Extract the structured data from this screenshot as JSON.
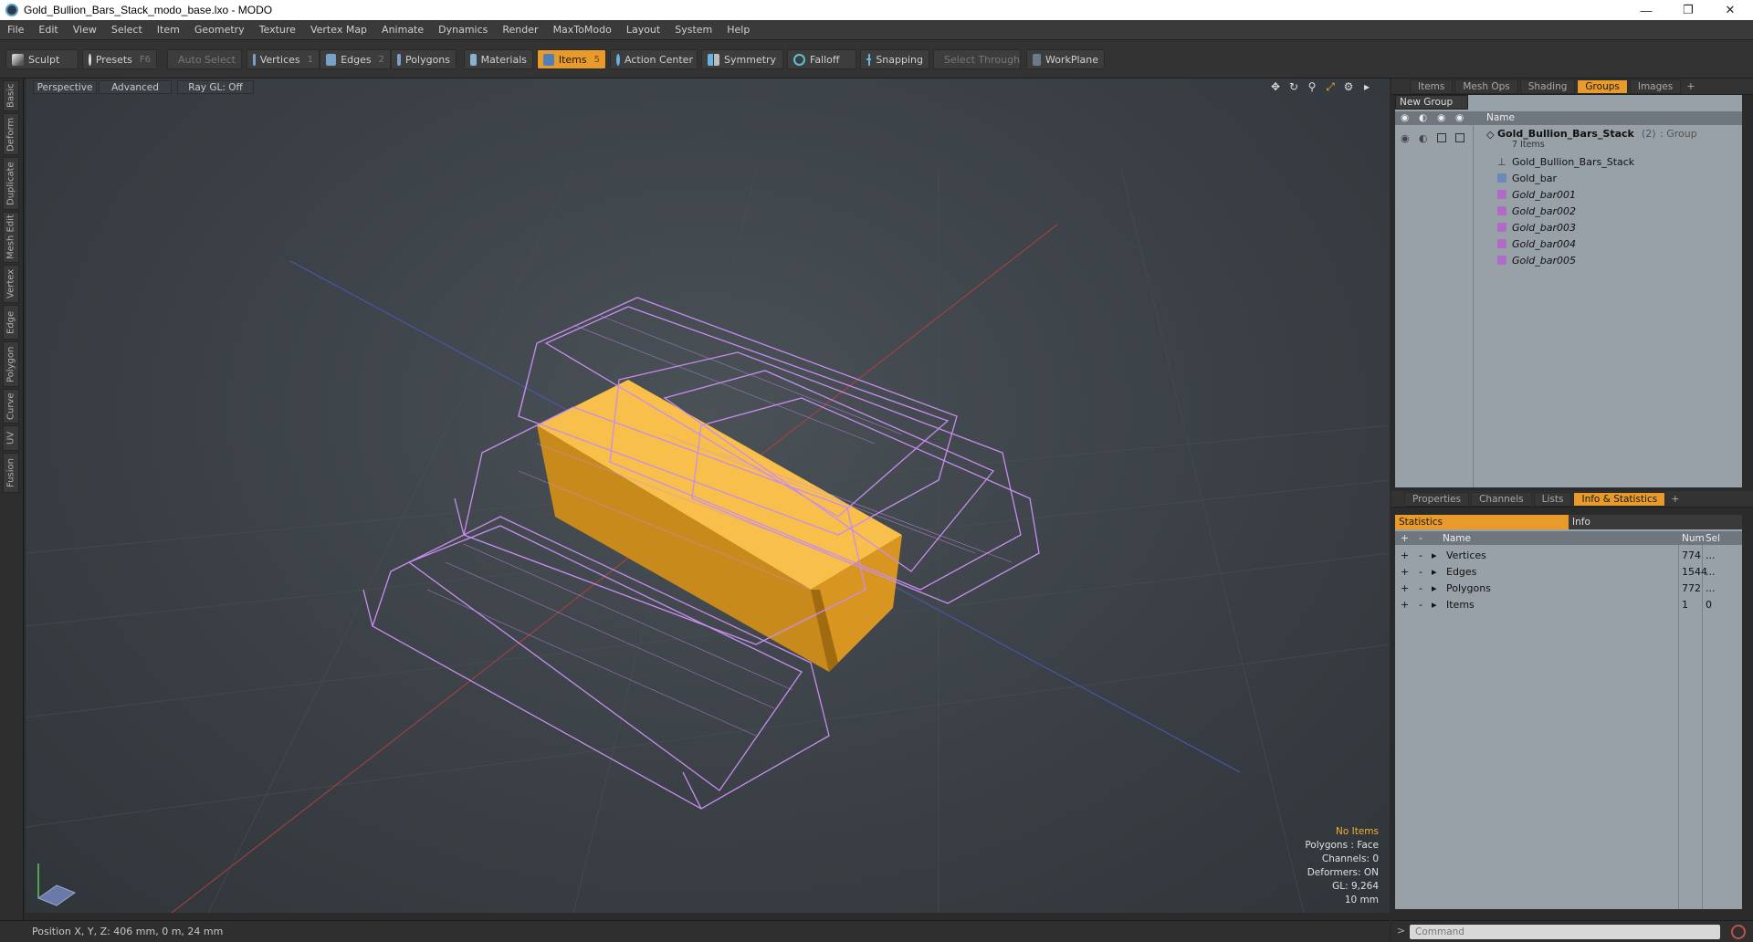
{
  "window": {
    "title": "Gold_Bullion_Bars_Stack_modo_base.lxo - MODO",
    "controls": [
      "minimize",
      "maximize",
      "close"
    ]
  },
  "menu": [
    "File",
    "Edit",
    "View",
    "Select",
    "Item",
    "Geometry",
    "Texture",
    "Vertex Map",
    "Animate",
    "Dynamics",
    "Render",
    "MaxToModo",
    "Layout",
    "System",
    "Help"
  ],
  "toolbar": {
    "sculpt": "Sculpt",
    "presets": "Presets",
    "presets_key": "F6",
    "auto_select": "Auto Select",
    "vertices": "Vertices",
    "vertices_key": "1",
    "edges": "Edges",
    "edges_key": "2",
    "polygons": "Polygons",
    "materials": "Materials",
    "items": "Items",
    "items_key": "5",
    "action_center": "Action Center",
    "symmetry": "Symmetry",
    "falloff": "Falloff",
    "snapping": "Snapping",
    "select_through": "Select Through",
    "workplane": "WorkPlane"
  },
  "left_tabs": [
    "Basic",
    "Deform",
    "Duplicate",
    "Mesh Edit",
    "Vertex",
    "Edge",
    "Polygon",
    "Curve",
    "UV",
    "Fusion"
  ],
  "viewport": {
    "view": "Perspective",
    "shading": "Advanced",
    "raygl": "Ray GL: Off",
    "info": {
      "selection": "No Items",
      "polygons": "Polygons : Face",
      "channels": "Channels: 0",
      "deformers": "Deformers: ON",
      "gl": "GL: 9,264",
      "grid": "10 mm"
    },
    "accent": "#f0b030",
    "wire_color": "#c88cf0",
    "gold_color": "#f4b43c"
  },
  "status": {
    "position": "Position X, Y, Z:  406 mm, 0 m, 24 mm"
  },
  "top_panel": {
    "tabs": [
      "Items",
      "Mesh Ops",
      "Shading",
      "Groups",
      "Images"
    ],
    "active_tab": "Groups",
    "new_group": "New Group",
    "col_name": "Name",
    "group": {
      "name": "Gold_Bullion_Bars_Stack",
      "count": "(2)",
      "type": ": Group",
      "items_count": "7 Items"
    },
    "items": [
      "Gold_Bullion_Bars_Stack",
      "Gold_bar",
      "Gold_bar001",
      "Gold_bar002",
      "Gold_bar003",
      "Gold_bar004",
      "Gold_bar005"
    ]
  },
  "bottom_panel": {
    "tabs": [
      "Properties",
      "Channels",
      "Lists",
      "Info & Statistics"
    ],
    "active_tab": "Info & Statistics",
    "subtabs": [
      "Statistics",
      "Info"
    ],
    "columns": [
      "Name",
      "Num",
      "Sel"
    ],
    "rows": [
      {
        "name": "Vertices",
        "num": "774",
        "sel": "..."
      },
      {
        "name": "Edges",
        "num": "1544",
        "sel": "..."
      },
      {
        "name": "Polygons",
        "num": "772",
        "sel": "..."
      },
      {
        "name": "Items",
        "num": "1",
        "sel": "0"
      }
    ]
  },
  "command": {
    "placeholder": "Command"
  }
}
